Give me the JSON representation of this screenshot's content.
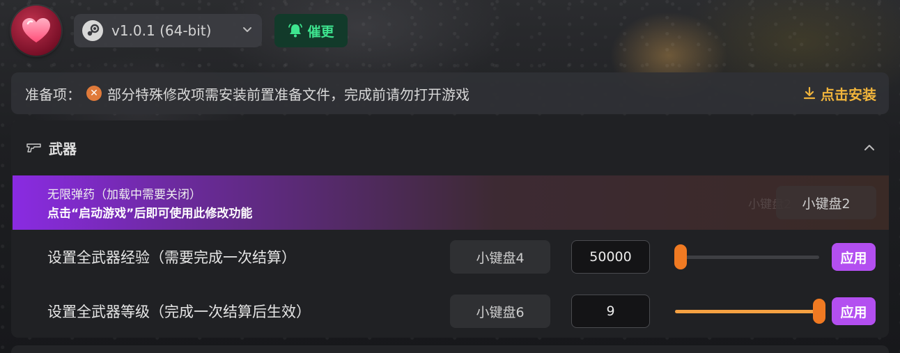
{
  "header": {
    "logo_icon": "heart-icon",
    "version_label": "v1.0.1 (64-bit)",
    "platform_icon": "steam-icon",
    "urge_label": "催更",
    "urge_icon": "bell-icon"
  },
  "prep": {
    "label": "准备项：",
    "message": "部分特殊修改项需安装前置准备文件，完成前请勿打开游戏",
    "install_label": "点击安装",
    "status_icon": "error-x-icon"
  },
  "section": {
    "title": "武器",
    "icon": "gun-icon",
    "feature": {
      "title": "无限弹药（加载中需要关闭）",
      "notice": "点击“启动游戏”后即可使用此修改功能",
      "hotkey": "小键盘2"
    },
    "rows": [
      {
        "label": "设置全武器经验（需要完成一次结算）",
        "hotkey": "小键盘4",
        "value": "50000",
        "slider_fraction": 0.04,
        "apply_label": "应用"
      },
      {
        "label": "设置全武器等级（完成一次结算后生效）",
        "hotkey": "小键盘6",
        "value": "9",
        "slider_fraction": 1.0,
        "apply_label": "应用"
      }
    ]
  },
  "colors": {
    "accent_purple": "#b34ff0",
    "slider_orange": "#f07a22",
    "install_gold": "#f0b43c",
    "urge_green": "#3ee48f"
  }
}
